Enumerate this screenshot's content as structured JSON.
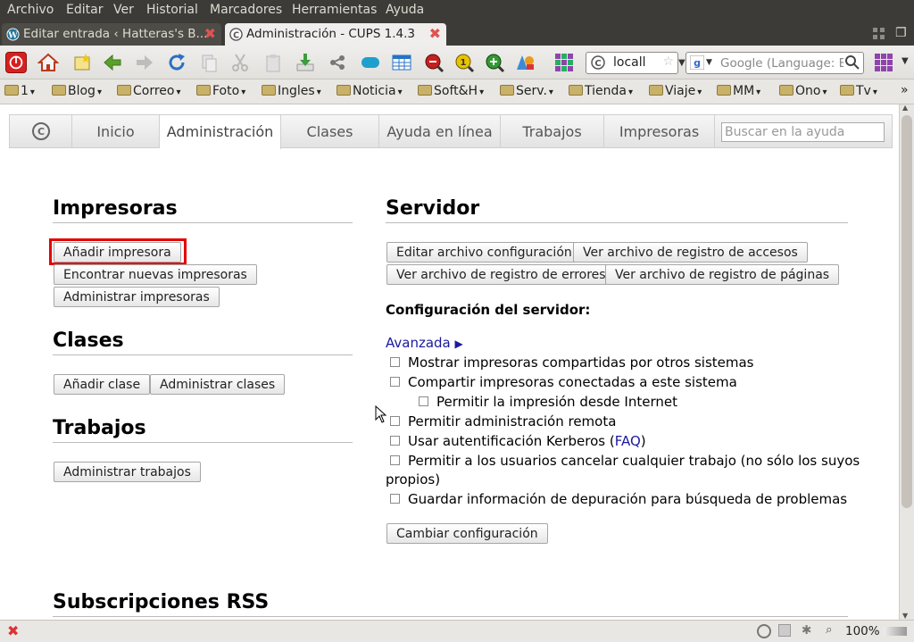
{
  "menu": [
    "Archivo",
    "Editar",
    "Ver",
    "Historial",
    "Marcadores",
    "Herramientas",
    "Ayuda"
  ],
  "tabs": [
    {
      "title": "Editar entrada ‹ Hatteras's B...",
      "active": false
    },
    {
      "title": "Administración - CUPS 1.4.3",
      "active": true
    }
  ],
  "url": "locall",
  "search_placeholder": "Google (Language: ES",
  "bookmarks": [
    "1",
    "Blog",
    "Correo",
    "Foto",
    "Ingles",
    "Noticia",
    "Soft&H",
    "Serv.",
    "Tienda",
    "Viaje",
    "MM",
    "Ono",
    "Tv"
  ],
  "bookmarks_more": "»",
  "cups_nav": [
    "Inicio",
    "Administración",
    "Clases",
    "Ayuda en línea",
    "Trabajos",
    "Impresoras"
  ],
  "cups_nav_active": "Administración",
  "help_search_placeholder": "Buscar en la ayuda",
  "printers": {
    "heading": "Impresoras",
    "buttons": [
      "Añadir impresora",
      "Encontrar nuevas impresoras",
      "Administrar impresoras"
    ]
  },
  "classes": {
    "heading": "Clases",
    "buttons": [
      "Añadir clase",
      "Administrar clases"
    ]
  },
  "jobs": {
    "heading": "Trabajos",
    "buttons": [
      "Administrar trabajos"
    ]
  },
  "server": {
    "heading": "Servidor",
    "buttons": [
      "Editar archivo configuración",
      "Ver archivo de registro de accesos",
      "Ver archivo de registro de errores",
      "Ver archivo de registro de páginas"
    ],
    "config_title": "Configuración del servidor:",
    "advanced_link": "Avanzada",
    "advanced_arrow": "▶",
    "options": [
      "Mostrar impresoras compartidas por otros sistemas",
      "Compartir impresoras conectadas a este sistema",
      "Permitir la impresión desde Internet",
      "Permitir administración remota",
      "Usar autentificación Kerberos (",
      "Permitir a los usuarios cancelar cualquier trabajo (no sólo los suyos",
      "Guardar información de depuración para búsqueda de problemas"
    ],
    "kerberos_link": "FAQ",
    "kerberos_close": ")",
    "option_wrap": "propios)",
    "apply_button": "Cambiar configuración"
  },
  "rss_heading": "Subscripciones RSS",
  "status": {
    "zoom": "100%"
  }
}
